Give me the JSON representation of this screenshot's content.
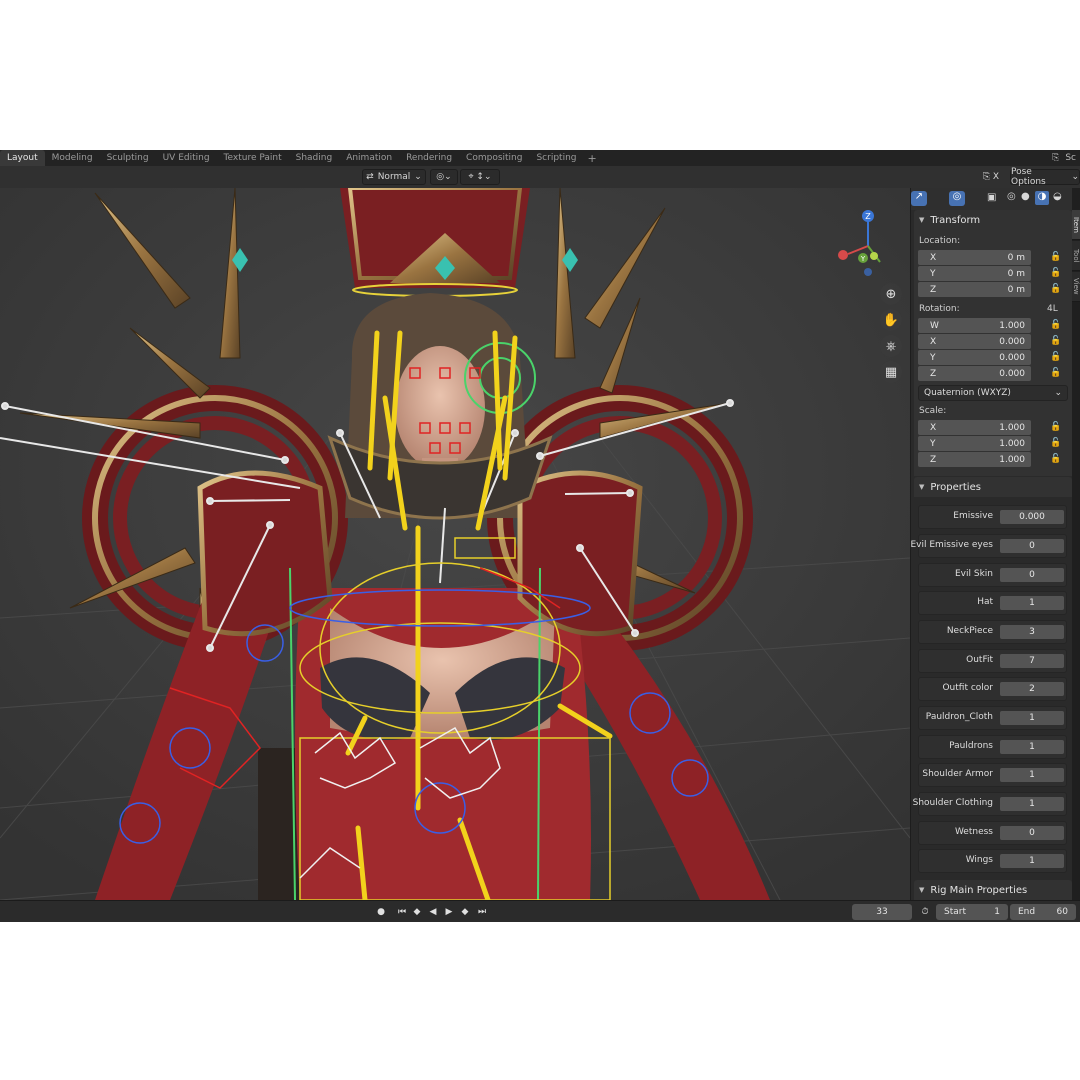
{
  "workspace_tabs": [
    "Layout",
    "Modeling",
    "Sculpting",
    "UV Editing",
    "Texture Paint",
    "Shading",
    "Animation",
    "Rendering",
    "Compositing",
    "Scripting"
  ],
  "topbar_right": "Sc",
  "header": {
    "transform_orientation": "Normal",
    "pose_options": "Pose Options"
  },
  "sidebar": {
    "tabs": [
      "Item",
      "Tool",
      "View"
    ],
    "transform": {
      "title": "Transform",
      "location_label": "Location:",
      "location": [
        {
          "axis": "X",
          "value": "0 m"
        },
        {
          "axis": "Y",
          "value": "0 m"
        },
        {
          "axis": "Z",
          "value": "0 m"
        }
      ],
      "rotation_label": "Rotation:",
      "rotation_mode_badge": "4L",
      "rotation": [
        {
          "axis": "W",
          "value": "1.000"
        },
        {
          "axis": "X",
          "value": "0.000"
        },
        {
          "axis": "Y",
          "value": "0.000"
        },
        {
          "axis": "Z",
          "value": "0.000"
        }
      ],
      "rotation_mode": "Quaternion (WXYZ)",
      "scale_label": "Scale:",
      "scale": [
        {
          "axis": "X",
          "value": "1.000"
        },
        {
          "axis": "Y",
          "value": "1.000"
        },
        {
          "axis": "Z",
          "value": "1.000"
        }
      ]
    },
    "properties": {
      "title": "Properties",
      "items": [
        {
          "label": "Emissive",
          "value": "0.000"
        },
        {
          "label": "Evil Emissive eyes",
          "value": "0"
        },
        {
          "label": "Evil Skin",
          "value": "0"
        },
        {
          "label": "Hat",
          "value": "1"
        },
        {
          "label": "NeckPiece",
          "value": "3"
        },
        {
          "label": "OutFit",
          "value": "7"
        },
        {
          "label": "Outfit color",
          "value": "2"
        },
        {
          "label": "Pauldron_Cloth",
          "value": "1"
        },
        {
          "label": "Pauldrons",
          "value": "1"
        },
        {
          "label": "Shoulder Armor",
          "value": "1"
        },
        {
          "label": "Shoulder Clothing",
          "value": "1"
        },
        {
          "label": "Wetness",
          "value": "0"
        },
        {
          "label": "Wings",
          "value": "1"
        }
      ]
    },
    "rig_main_title": "Rig Main Properties"
  },
  "gizmo": {
    "x": "X",
    "y": "Y",
    "z": "Z"
  },
  "timeline": {
    "current_frame": "33",
    "start_label": "Start",
    "start_value": "1",
    "end_label": "End",
    "end_value": "60"
  },
  "colors": {
    "bone_yellow": "#f2d21c",
    "bone_white": "#e8e8e8",
    "bone_green": "#4ad36a",
    "widget_blue": "#3a5fe6",
    "widget_red": "#e02323",
    "armor_gold": "#b08a4a",
    "cloth_red": "#7a1f22"
  },
  "icons": [
    "arrow-icon",
    "snap-icon",
    "proportional-icon",
    "zoom-icon",
    "hand-icon",
    "camera-icon",
    "grid-icon",
    "lock-icon",
    "record-icon",
    "play-icon",
    "stopwatch-icon"
  ]
}
